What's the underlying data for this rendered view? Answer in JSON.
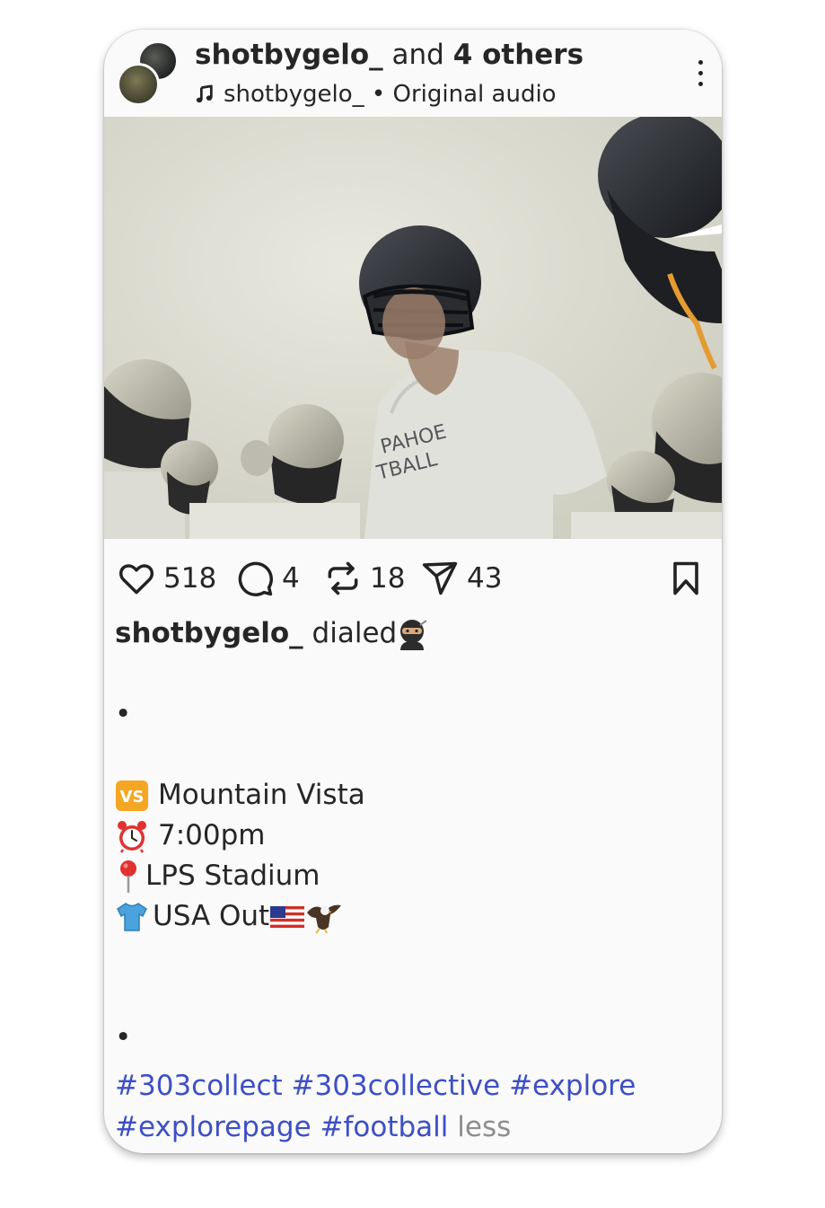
{
  "header": {
    "username": "shotbygelo_",
    "and_text": " and ",
    "others": "4 others",
    "audio_user": "shotbygelo_",
    "audio_sep": " • ",
    "audio_label": "Original audio"
  },
  "actions": {
    "likes": "518",
    "comments": "4",
    "reposts": "18",
    "shares": "43"
  },
  "caption": {
    "username": "shotbygelo_",
    "text": "dialed",
    "bullet1": "•",
    "vs_badge": "VS",
    "opponent": "Mountain Vista",
    "time": "7:00pm",
    "location": "LPS Stadium",
    "attire": "USA Out",
    "bullet2": "•"
  },
  "hashtags": {
    "line1": [
      "#303collect",
      "#303collective",
      "#explore"
    ],
    "line2": [
      "#explorepage",
      "#football"
    ],
    "less": "less"
  },
  "media": {
    "jersey_text_1": "PAHOE",
    "jersey_text_2": "TBALL"
  },
  "colors": {
    "hashtag": "#3d4fc6",
    "less": "#8e8e8e",
    "card_bg": "#fafafa"
  },
  "icons": [
    "music-note-icon",
    "more-vertical-icon",
    "heart-icon",
    "comment-icon",
    "repost-icon",
    "share-icon",
    "bookmark-icon"
  ]
}
